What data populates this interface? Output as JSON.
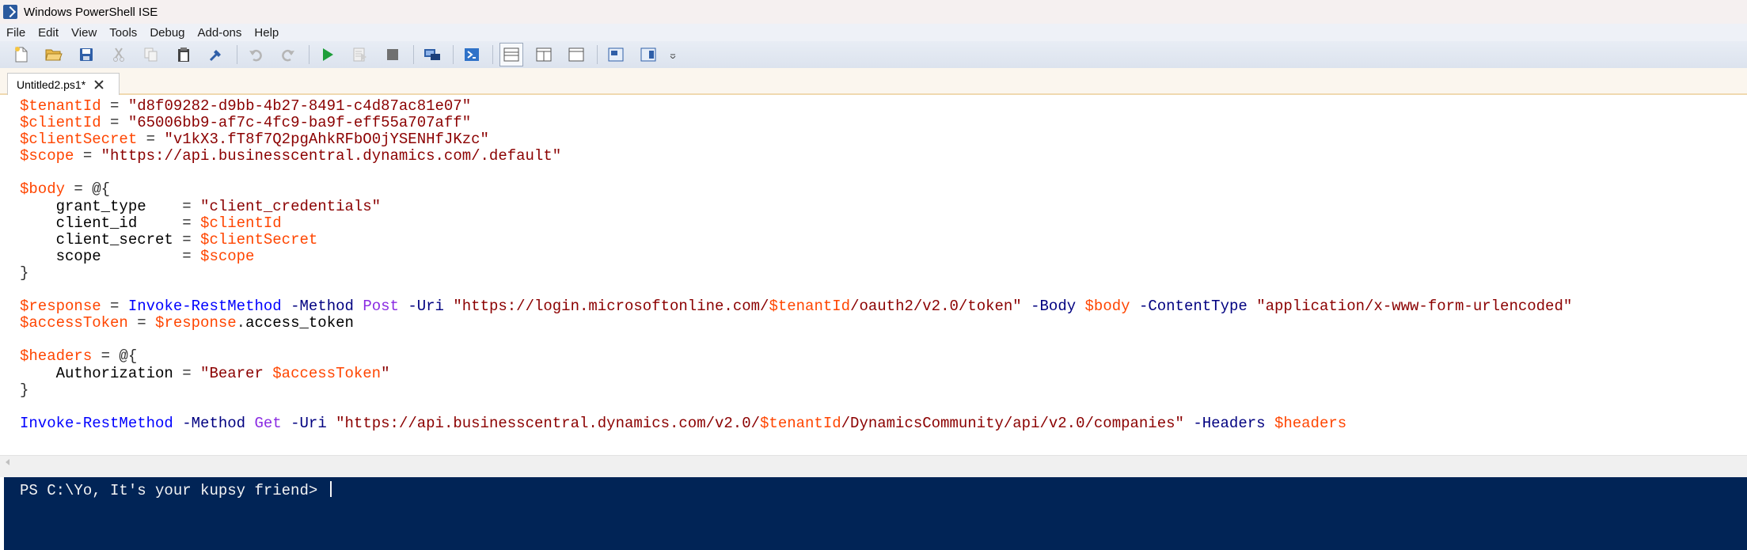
{
  "window": {
    "title": "Windows PowerShell ISE"
  },
  "menu": [
    "File",
    "Edit",
    "View",
    "Tools",
    "Debug",
    "Add-ons",
    "Help"
  ],
  "toolbar": {
    "buttons": [
      "new-icon",
      "open-icon",
      "save-icon",
      "cut-icon",
      "copy-icon",
      "paste-icon",
      "clear-icon",
      "undo-icon",
      "redo-icon",
      "run-icon",
      "run-selection-icon",
      "stop-icon",
      "remote-powershell-icon",
      "start-powershell-icon",
      "show-script-top-icon",
      "show-script-right-icon",
      "show-script-maximized-icon",
      "show-command-window-icon",
      "show-command-addon-icon",
      "toolbar-overflow-icon"
    ]
  },
  "tabs": [
    {
      "label": "Untitled2.ps1*"
    }
  ],
  "editor": {
    "lines": [
      [
        {
          "t": "$tenantId",
          "c": "var"
        },
        {
          "t": " = ",
          "c": "op"
        },
        {
          "t": "\"d8f09282-d9bb-4b27-8491-c4d87ac81e07\"",
          "c": "str"
        }
      ],
      [
        {
          "t": "$clientId",
          "c": "var"
        },
        {
          "t": " = ",
          "c": "op"
        },
        {
          "t": "\"65006bb9-af7c-4fc9-ba9f-eff55a707aff\"",
          "c": "str"
        }
      ],
      [
        {
          "t": "$clientSecret",
          "c": "var"
        },
        {
          "t": " = ",
          "c": "op"
        },
        {
          "t": "\"v1kX3.fT8f7Q2pgAhkRFbO0jYSENHfJKzc\"",
          "c": "str"
        }
      ],
      [
        {
          "t": "$scope",
          "c": "var"
        },
        {
          "t": " = ",
          "c": "op"
        },
        {
          "t": "\"https://api.businesscentral.dynamics.com/.default\"",
          "c": "str"
        }
      ],
      [],
      [
        {
          "t": "$body",
          "c": "var"
        },
        {
          "t": " = @{",
          "c": "op"
        }
      ],
      [
        {
          "t": "    grant_type    ",
          "c": "plain"
        },
        {
          "t": "= ",
          "c": "op"
        },
        {
          "t": "\"client_credentials\"",
          "c": "str"
        }
      ],
      [
        {
          "t": "    client_id     ",
          "c": "plain"
        },
        {
          "t": "= ",
          "c": "op"
        },
        {
          "t": "$clientId",
          "c": "var"
        }
      ],
      [
        {
          "t": "    client_secret ",
          "c": "plain"
        },
        {
          "t": "= ",
          "c": "op"
        },
        {
          "t": "$clientSecret",
          "c": "var"
        }
      ],
      [
        {
          "t": "    scope         ",
          "c": "plain"
        },
        {
          "t": "= ",
          "c": "op"
        },
        {
          "t": "$scope",
          "c": "var"
        }
      ],
      [
        {
          "t": "}",
          "c": "op"
        }
      ],
      [],
      [
        {
          "t": "$response",
          "c": "var"
        },
        {
          "t": " = ",
          "c": "op"
        },
        {
          "t": "Invoke-RestMethod",
          "c": "cmd"
        },
        {
          "t": " ",
          "c": "plain"
        },
        {
          "t": "-Method",
          "c": "param"
        },
        {
          "t": " ",
          "c": "plain"
        },
        {
          "t": "Post",
          "c": "kw"
        },
        {
          "t": " ",
          "c": "plain"
        },
        {
          "t": "-Uri",
          "c": "param"
        },
        {
          "t": " ",
          "c": "plain"
        },
        {
          "t": "\"https://login.microsoftonline.com/",
          "c": "str"
        },
        {
          "t": "$tenantId",
          "c": "var"
        },
        {
          "t": "/oauth2/v2.0/token\"",
          "c": "str"
        },
        {
          "t": " ",
          "c": "plain"
        },
        {
          "t": "-Body",
          "c": "param"
        },
        {
          "t": " ",
          "c": "plain"
        },
        {
          "t": "$body",
          "c": "var"
        },
        {
          "t": " ",
          "c": "plain"
        },
        {
          "t": "-ContentType",
          "c": "param"
        },
        {
          "t": " ",
          "c": "plain"
        },
        {
          "t": "\"application/x-www-form-urlencoded\"",
          "c": "str"
        }
      ],
      [
        {
          "t": "$accessToken",
          "c": "var"
        },
        {
          "t": " = ",
          "c": "op"
        },
        {
          "t": "$response",
          "c": "var"
        },
        {
          "t": ".",
          "c": "op"
        },
        {
          "t": "access_token",
          "c": "plain"
        }
      ],
      [],
      [
        {
          "t": "$headers",
          "c": "var"
        },
        {
          "t": " = @{",
          "c": "op"
        }
      ],
      [
        {
          "t": "    Authorization ",
          "c": "plain"
        },
        {
          "t": "= ",
          "c": "op"
        },
        {
          "t": "\"Bearer ",
          "c": "str"
        },
        {
          "t": "$accessToken",
          "c": "var"
        },
        {
          "t": "\"",
          "c": "str"
        }
      ],
      [
        {
          "t": "}",
          "c": "op"
        }
      ],
      [],
      [
        {
          "t": "Invoke-RestMethod",
          "c": "cmd"
        },
        {
          "t": " ",
          "c": "plain"
        },
        {
          "t": "-Method",
          "c": "param"
        },
        {
          "t": " ",
          "c": "plain"
        },
        {
          "t": "Get",
          "c": "kw"
        },
        {
          "t": " ",
          "c": "plain"
        },
        {
          "t": "-Uri",
          "c": "param"
        },
        {
          "t": " ",
          "c": "plain"
        },
        {
          "t": "\"https://api.businesscentral.dynamics.com/v2.0/",
          "c": "str"
        },
        {
          "t": "$tenantId",
          "c": "var"
        },
        {
          "t": "/DynamicsCommunity/api/v2.0/companies\"",
          "c": "str"
        },
        {
          "t": " ",
          "c": "plain"
        },
        {
          "t": "-Headers",
          "c": "param"
        },
        {
          "t": " ",
          "c": "plain"
        },
        {
          "t": "$headers",
          "c": "var"
        }
      ]
    ]
  },
  "console": {
    "prompt": "PS C:\\Yo, It's your kupsy friend> "
  },
  "colors": {
    "console_bg": "#012456",
    "variable": "#ff4500",
    "string": "#8b0000",
    "command": "#0000ff",
    "parameter": "#000080",
    "keyword": "#8a2be2"
  }
}
